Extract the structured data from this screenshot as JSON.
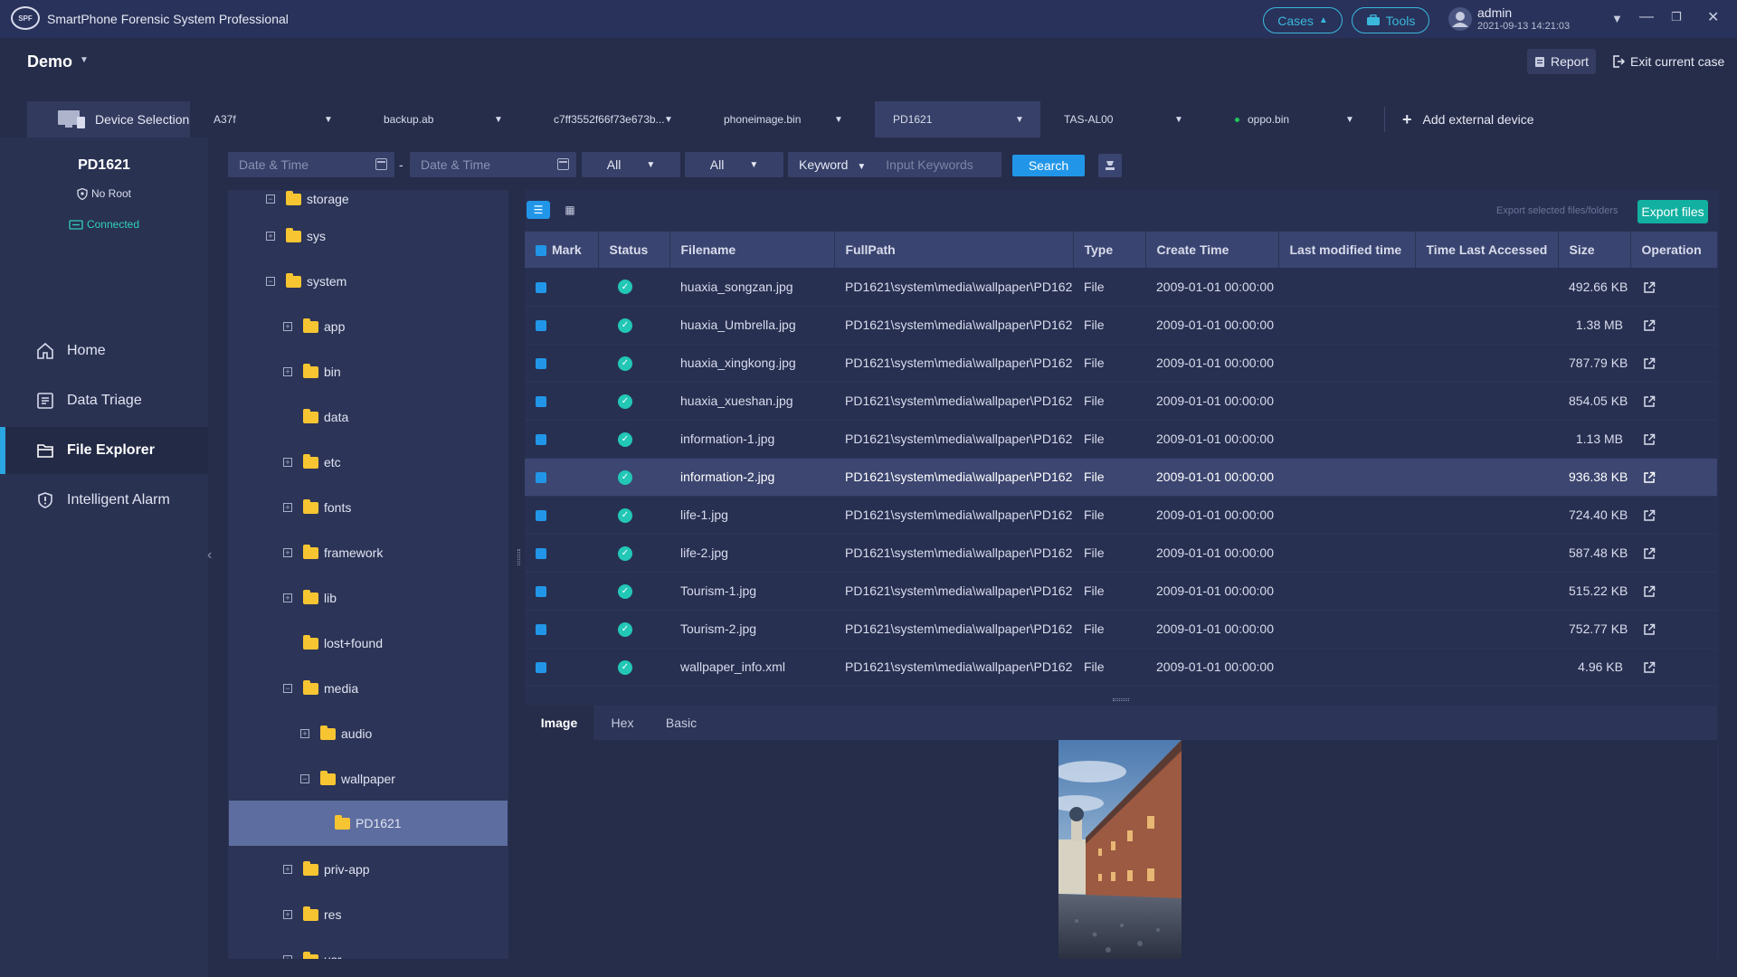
{
  "app": {
    "logo_text": "SPF",
    "title": "SmartPhone Forensic System Professional",
    "cases_label": "Cases",
    "tools_label": "Tools",
    "user": {
      "name": "admin",
      "time": "2021-09-13 14:21:03"
    }
  },
  "case": {
    "name": "Demo",
    "report_label": "Report",
    "exit_label": "Exit current case"
  },
  "devices": {
    "selection_label": "Device Selection",
    "tabs": [
      {
        "label": "A37f"
      },
      {
        "label": "backup.ab"
      },
      {
        "label": "c7ff3552f66f73e673b..."
      },
      {
        "label": "phoneimage.bin"
      },
      {
        "label": "PD1621"
      },
      {
        "label": "TAS-AL00"
      },
      {
        "label": "oppo.bin"
      }
    ],
    "add_label": "Add external device"
  },
  "device_info": {
    "name": "PD1621",
    "root": "No Root",
    "connection": "Connected"
  },
  "nav": [
    {
      "label": "Home",
      "icon": "home-icon"
    },
    {
      "label": "Data Triage",
      "icon": "data-triage-icon"
    },
    {
      "label": "File Explorer",
      "icon": "folder-icon"
    },
    {
      "label": "Intelligent Alarm",
      "icon": "alarm-icon"
    }
  ],
  "filters": {
    "start_date_placeholder": "Date & Time",
    "end_date_placeholder": "Date & Time",
    "separator": "-",
    "type_filter": "All",
    "status_filter": "All",
    "keyword_mode": "Keyword",
    "keyword_placeholder": "Input Keywords",
    "search_label": "Search"
  },
  "tree": [
    {
      "label": "storage"
    },
    {
      "label": "sys"
    },
    {
      "label": "system"
    },
    {
      "label": "app"
    },
    {
      "label": "bin"
    },
    {
      "label": "data"
    },
    {
      "label": "etc"
    },
    {
      "label": "fonts"
    },
    {
      "label": "framework"
    },
    {
      "label": "lib"
    },
    {
      "label": "lost+found"
    },
    {
      "label": "media"
    },
    {
      "label": "audio"
    },
    {
      "label": "wallpaper"
    },
    {
      "label": "PD1621"
    },
    {
      "label": "priv-app"
    },
    {
      "label": "res"
    },
    {
      "label": "usr"
    }
  ],
  "toolbar": {
    "export_selected": "Export selected files/folders",
    "export_files": "Export files"
  },
  "table": {
    "columns": [
      "Mark",
      "Status",
      "Filename",
      "FullPath",
      "Type",
      "Create Time",
      "Last modified time",
      "Time Last Accessed",
      "Size",
      "Operation"
    ],
    "rows": [
      {
        "filename": "huaxia_songzan.jpg",
        "path": "PD1621\\system\\media\\wallpaper\\PD162",
        "type": "File",
        "created": "2009-01-01 00:00:00",
        "modified": "",
        "accessed": "",
        "size": "492.66 KB"
      },
      {
        "filename": "huaxia_Umbrella.jpg",
        "path": "PD1621\\system\\media\\wallpaper\\PD162",
        "type": "File",
        "created": "2009-01-01 00:00:00",
        "modified": "",
        "accessed": "",
        "size": "1.38 MB"
      },
      {
        "filename": "huaxia_xingkong.jpg",
        "path": "PD1621\\system\\media\\wallpaper\\PD162",
        "type": "File",
        "created": "2009-01-01 00:00:00",
        "modified": "",
        "accessed": "",
        "size": "787.79 KB"
      },
      {
        "filename": "huaxia_xueshan.jpg",
        "path": "PD1621\\system\\media\\wallpaper\\PD162",
        "type": "File",
        "created": "2009-01-01 00:00:00",
        "modified": "",
        "accessed": "",
        "size": "854.05 KB"
      },
      {
        "filename": "information-1.jpg",
        "path": "PD1621\\system\\media\\wallpaper\\PD162",
        "type": "File",
        "created": "2009-01-01 00:00:00",
        "modified": "",
        "accessed": "",
        "size": "1.13 MB"
      },
      {
        "filename": "information-2.jpg",
        "path": "PD1621\\system\\media\\wallpaper\\PD162",
        "type": "File",
        "created": "2009-01-01 00:00:00",
        "modified": "",
        "accessed": "",
        "size": "936.38 KB"
      },
      {
        "filename": "life-1.jpg",
        "path": "PD1621\\system\\media\\wallpaper\\PD162",
        "type": "File",
        "created": "2009-01-01 00:00:00",
        "modified": "",
        "accessed": "",
        "size": "724.40 KB"
      },
      {
        "filename": "life-2.jpg",
        "path": "PD1621\\system\\media\\wallpaper\\PD162",
        "type": "File",
        "created": "2009-01-01 00:00:00",
        "modified": "",
        "accessed": "",
        "size": "587.48 KB"
      },
      {
        "filename": "Tourism-1.jpg",
        "path": "PD1621\\system\\media\\wallpaper\\PD162",
        "type": "File",
        "created": "2009-01-01 00:00:00",
        "modified": "",
        "accessed": "",
        "size": "515.22 KB"
      },
      {
        "filename": "Tourism-2.jpg",
        "path": "PD1621\\system\\media\\wallpaper\\PD162",
        "type": "File",
        "created": "2009-01-01 00:00:00",
        "modified": "",
        "accessed": "",
        "size": "752.77 KB"
      },
      {
        "filename": "wallpaper_info.xml",
        "path": "PD1621\\system\\media\\wallpaper\\PD162",
        "type": "File",
        "created": "2009-01-01 00:00:00",
        "modified": "",
        "accessed": "",
        "size": "4.96 KB"
      }
    ]
  },
  "preview": {
    "tabs": [
      "Image",
      "Hex",
      "Basic"
    ]
  },
  "colors": {
    "accent": "#2196e8",
    "export_teal": "#12b0a0",
    "connected": "#2fd0b8",
    "folder": "#f7c531"
  }
}
